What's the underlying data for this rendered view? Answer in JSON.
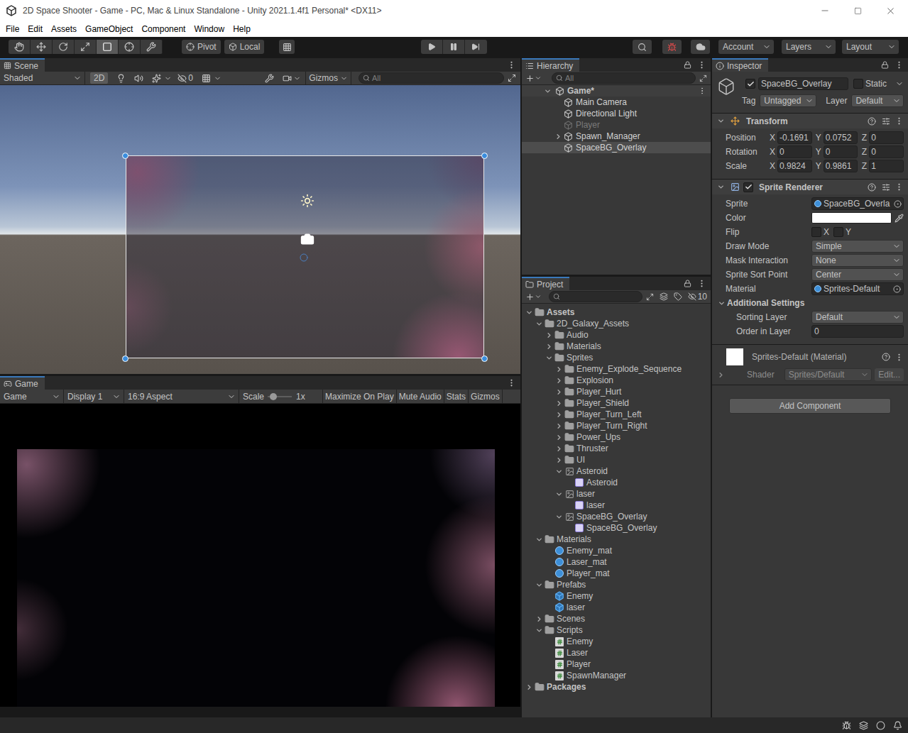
{
  "window": {
    "title": "2D Space Shooter - Game - PC, Mac & Linux Standalone - Unity 2021.1.4f1 Personal* <DX11>"
  },
  "menu": [
    "File",
    "Edit",
    "Assets",
    "GameObject",
    "Component",
    "Window",
    "Help"
  ],
  "toolbar": {
    "tools": [
      {
        "kind": "hand",
        "selected": false
      },
      {
        "kind": "move",
        "selected": false
      },
      {
        "kind": "rotate",
        "selected": false
      },
      {
        "kind": "scale",
        "selected": false
      },
      {
        "kind": "rect",
        "selected": true
      },
      {
        "kind": "transform",
        "selected": false
      },
      {
        "kind": "custom",
        "selected": false
      }
    ],
    "pivot": "Pivot",
    "local": "Local",
    "playing": false,
    "paused": false,
    "account": "Account",
    "layers": "Layers",
    "layout": "Layout"
  },
  "scene": {
    "tab": "Scene",
    "shading": "Shaded",
    "mode_2d": {
      "label": "2D",
      "selected": true
    },
    "hidden_count": "0",
    "gizmos": "Gizmos",
    "search_placeholder": "All",
    "sprite_selected": true
  },
  "game": {
    "tab": "Game",
    "view": "Game",
    "display": "Display 1",
    "aspect": "16:9 Aspect",
    "scale_label": "Scale",
    "scale_level": 0.12,
    "scale_value": "1x",
    "toggles": [
      {
        "label": "Maximize On Play",
        "selected": false
      },
      {
        "label": "Mute Audio",
        "selected": false
      },
      {
        "label": "Stats",
        "selected": false
      },
      {
        "label": "Gizmos",
        "selected": false
      }
    ]
  },
  "hierarchy": {
    "tab": "Hierarchy",
    "search_placeholder": "All",
    "scene": {
      "name": "Game*",
      "expanded": true
    },
    "items": [
      {
        "name": "Main Camera",
        "disabled": false,
        "selected": false,
        "expandable": false,
        "expanded": false
      },
      {
        "name": "Directional Light",
        "disabled": false,
        "selected": false,
        "expandable": false,
        "expanded": false
      },
      {
        "name": "Player",
        "disabled": true,
        "selected": false,
        "expandable": false,
        "expanded": false
      },
      {
        "name": "Spawn_Manager",
        "disabled": false,
        "selected": false,
        "expandable": true,
        "expanded": false
      },
      {
        "name": "SpaceBG_Overlay",
        "disabled": false,
        "selected": true,
        "expandable": false,
        "expanded": false
      }
    ]
  },
  "project": {
    "tab": "Project",
    "hidden_count": "10",
    "items": [
      {
        "name": "Assets",
        "kind": "folder",
        "expandable": true,
        "expanded": true,
        "selected": false,
        "children": [
          {
            "name": "2D_Galaxy_Assets",
            "kind": "folder",
            "expandable": true,
            "expanded": true,
            "selected": false,
            "children": [
              {
                "name": "Audio",
                "kind": "folder",
                "expandable": true,
                "expanded": false,
                "selected": false
              },
              {
                "name": "Materials",
                "kind": "folder",
                "expandable": true,
                "expanded": false,
                "selected": false
              },
              {
                "name": "Sprites",
                "kind": "folder",
                "expandable": true,
                "expanded": true,
                "selected": false,
                "children": [
                  {
                    "name": "Enemy_Explode_Sequence",
                    "kind": "folder",
                    "expandable": true,
                    "expanded": false,
                    "selected": false
                  },
                  {
                    "name": "Explosion",
                    "kind": "folder",
                    "expandable": true,
                    "expanded": false,
                    "selected": false
                  },
                  {
                    "name": "Player_Hurt",
                    "kind": "folder",
                    "expandable": true,
                    "expanded": false,
                    "selected": false
                  },
                  {
                    "name": "Player_Shield",
                    "kind": "folder",
                    "expandable": true,
                    "expanded": false,
                    "selected": false
                  },
                  {
                    "name": "Player_Turn_Left",
                    "kind": "folder",
                    "expandable": true,
                    "expanded": false,
                    "selected": false
                  },
                  {
                    "name": "Player_Turn_Right",
                    "kind": "folder",
                    "expandable": true,
                    "expanded": false,
                    "selected": false
                  },
                  {
                    "name": "Power_Ups",
                    "kind": "folder",
                    "expandable": true,
                    "expanded": false,
                    "selected": false
                  },
                  {
                    "name": "Thruster",
                    "kind": "folder",
                    "expandable": true,
                    "expanded": false,
                    "selected": false
                  },
                  {
                    "name": "UI",
                    "kind": "folder",
                    "expandable": true,
                    "expanded": false,
                    "selected": false
                  },
                  {
                    "name": "Asteroid",
                    "kind": "texture",
                    "expandable": true,
                    "expanded": true,
                    "selected": false,
                    "children": [
                      {
                        "name": "Asteroid",
                        "kind": "sprite",
                        "expandable": false,
                        "expanded": false,
                        "selected": false
                      }
                    ]
                  },
                  {
                    "name": "laser",
                    "kind": "texture",
                    "expandable": true,
                    "expanded": true,
                    "selected": false,
                    "children": [
                      {
                        "name": "laser",
                        "kind": "sprite",
                        "expandable": false,
                        "expanded": false,
                        "selected": false
                      }
                    ]
                  },
                  {
                    "name": "SpaceBG_Overlay",
                    "kind": "texture",
                    "expandable": true,
                    "expanded": true,
                    "selected": false,
                    "children": [
                      {
                        "name": "SpaceBG_Overlay",
                        "kind": "sprite",
                        "expandable": false,
                        "expanded": false,
                        "selected": false
                      }
                    ]
                  }
                ]
              }
            ]
          },
          {
            "name": "Materials",
            "kind": "folder",
            "expandable": true,
            "expanded": true,
            "selected": false,
            "children": [
              {
                "name": "Enemy_mat",
                "kind": "material",
                "expandable": false,
                "expanded": false,
                "selected": false
              },
              {
                "name": "Laser_mat",
                "kind": "material",
                "expandable": false,
                "expanded": false,
                "selected": false
              },
              {
                "name": "Player_mat",
                "kind": "material",
                "expandable": false,
                "expanded": false,
                "selected": false
              }
            ]
          },
          {
            "name": "Prefabs",
            "kind": "folder",
            "expandable": true,
            "expanded": true,
            "selected": false,
            "children": [
              {
                "name": "Enemy",
                "kind": "prefab",
                "expandable": false,
                "expanded": false,
                "selected": false
              },
              {
                "name": "laser",
                "kind": "prefab",
                "expandable": false,
                "expanded": false,
                "selected": false
              }
            ]
          },
          {
            "name": "Scenes",
            "kind": "folder",
            "expandable": true,
            "expanded": false,
            "selected": false
          },
          {
            "name": "Scripts",
            "kind": "folder",
            "expandable": true,
            "expanded": true,
            "selected": false,
            "children": [
              {
                "name": "Enemy",
                "kind": "script",
                "expandable": false,
                "expanded": false,
                "selected": false
              },
              {
                "name": "Laser",
                "kind": "script",
                "expandable": false,
                "expanded": false,
                "selected": false
              },
              {
                "name": "Player",
                "kind": "script",
                "expandable": false,
                "expanded": false,
                "selected": false
              },
              {
                "name": "SpawnManager",
                "kind": "script",
                "expandable": false,
                "expanded": false,
                "selected": false
              }
            ]
          }
        ]
      },
      {
        "name": "Packages",
        "kind": "folder",
        "expandable": true,
        "expanded": false,
        "selected": false
      }
    ]
  },
  "inspector": {
    "tab": "Inspector",
    "object": {
      "name": "SpaceBG_Overlay",
      "active": true,
      "static_label": "Static",
      "static": false,
      "tag_label": "Tag",
      "tag": "Untagged",
      "layer_label": "Layer",
      "layer": "Default"
    },
    "transform": {
      "title": "Transform",
      "expanded": true,
      "rows": [
        {
          "label": "Position",
          "values": [
            {
              "axis": "X",
              "value": "-0.1691"
            },
            {
              "axis": "Y",
              "value": "0.0752"
            },
            {
              "axis": "Z",
              "value": "0"
            }
          ]
        },
        {
          "label": "Rotation",
          "values": [
            {
              "axis": "X",
              "value": "0"
            },
            {
              "axis": "Y",
              "value": "0"
            },
            {
              "axis": "Z",
              "value": "0"
            }
          ]
        },
        {
          "label": "Scale",
          "values": [
            {
              "axis": "X",
              "value": "0.9824"
            },
            {
              "axis": "Y",
              "value": "0.9861"
            },
            {
              "axis": "Z",
              "value": "1"
            }
          ]
        }
      ]
    },
    "sprite_renderer": {
      "title": "Sprite Renderer",
      "enabled": true,
      "expanded": true,
      "fields": [
        {
          "label": "Sprite",
          "kind": "object",
          "value": "SpaceBG_Overla"
        },
        {
          "label": "Color",
          "kind": "color",
          "color": "#ffffff"
        },
        {
          "label": "Flip",
          "kind": "flip",
          "flags": [
            {
              "axis": "X",
              "checked": false
            },
            {
              "axis": "Y",
              "checked": false
            }
          ]
        },
        {
          "label": "Draw Mode",
          "kind": "dropdown",
          "value": "Simple"
        },
        {
          "label": "Mask Interaction",
          "kind": "dropdown",
          "value": "None"
        },
        {
          "label": "Sprite Sort Point",
          "kind": "dropdown",
          "value": "Center"
        },
        {
          "label": "Material",
          "kind": "object",
          "value": "Sprites-Default"
        }
      ],
      "additional": {
        "title": "Additional Settings",
        "expanded": true,
        "fields": [
          {
            "label": "Sorting Layer",
            "kind": "dropdown",
            "value": "Default"
          },
          {
            "label": "Order in Layer",
            "kind": "text",
            "value": "0"
          }
        ]
      }
    },
    "material": {
      "title": "Sprites-Default (Material)",
      "expanded": false,
      "shader_label": "Shader",
      "shader": "Sprites/Default",
      "edit": "Edit..."
    },
    "add_component": "Add Component"
  }
}
